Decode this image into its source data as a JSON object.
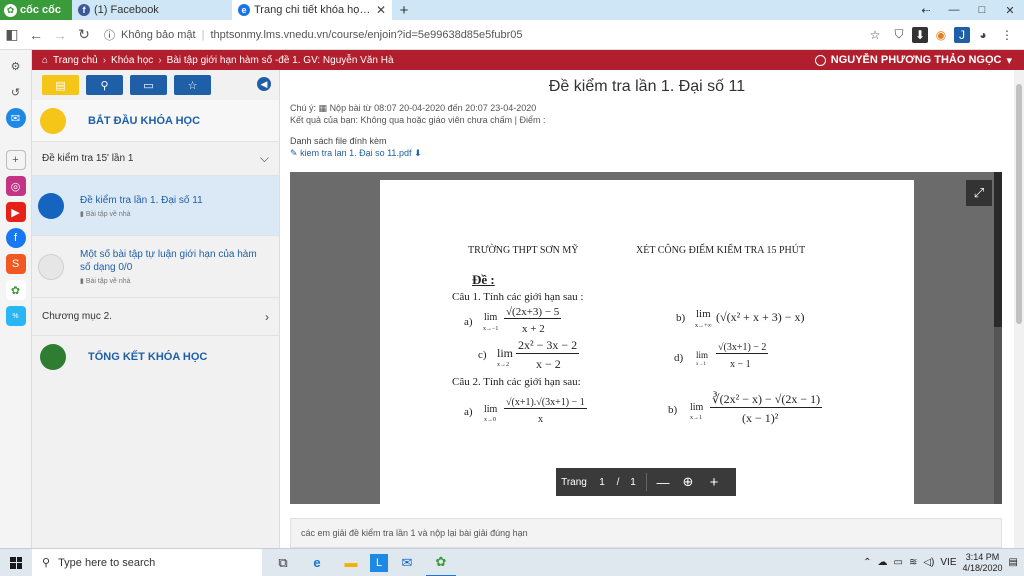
{
  "browser": {
    "brand": "cốc cốc",
    "tabs": [
      {
        "title": "(1) Facebook",
        "active": false
      },
      {
        "title": "Trang chi tiết khóa học: Bài tậ",
        "active": true
      }
    ],
    "address": {
      "security": "Không bảo mật",
      "url": "thptsonmy.lms.vnedu.vn/course/enjoin?id=5e99638d85e5fubr05"
    }
  },
  "site": {
    "breadcrumbs": [
      "Trang chủ",
      "Khóa học",
      "Bài tập giới hạn hàm số -đề 1. GV: Nguyễn Văn Hà"
    ],
    "user": "NGUYỄN PHƯƠNG THẢO NGỌC"
  },
  "course_panel": {
    "start": "BẮT ĐẦU KHÓA HỌC",
    "section1": "Đề kiểm tra 15' lần 1",
    "items": [
      {
        "title": "Đề kiểm tra lần 1. Đại số 11",
        "sub": "Bài tập về nhà",
        "selected": true
      },
      {
        "title": "Một số bài tập tự luận giới hạn của hàm số dạng 0/0",
        "sub": "Bài tập về nhà",
        "selected": false
      }
    ],
    "section2": "Chương mục 2.",
    "end": "TỔNG KẾT KHÓA HỌC"
  },
  "main": {
    "title": "Đề kiểm tra lần 1. Đại số 11",
    "note_label": "Chú ý:",
    "note": "Nộp bài từ 08:07 20-04-2020 đến 20:07 23-04-2020",
    "result": "Kết quả của bạn: Không qua hoặc giáo viên chưa chấm | Điểm :",
    "files_label": "Danh sách file đính kèm",
    "file": "kiem tra lan 1. Đại so 11.pdf",
    "comment": "các em giải đề kiểm tra lần 1 và nộp lại bài giải đúng hạn"
  },
  "document": {
    "school": "TRƯỜNG THPT SƠN MỸ",
    "exam": "XÉT CÔNG ĐIỂM KIỂM TRA 15 PHÚT",
    "de": "Đề :",
    "q1": "Câu 1. Tính các giới hạn sau :",
    "q2": "Câu 2. Tính các giới hạn sau:",
    "parts": [
      "a)",
      "b)",
      "c)",
      "d)",
      "a)",
      "b)"
    ],
    "lim": "lim",
    "subs": [
      "x→−1",
      "x→+∞",
      "x→2",
      "x→1",
      "x→0",
      "x→1"
    ],
    "num1": "√(2x+3) − 5",
    "den1": "x + 2",
    "expr_b": "(√(x² + x + 3) − x)",
    "num_c": "2x² − 3x − 2",
    "den_c": "x − 2",
    "num_d": "√(3x+1) − 2",
    "den_d": "x − 1",
    "num_2a": "√(x+1).√(3x+1) − 1",
    "den_2a": "x",
    "num_2b": "∛(2x² − x) − √(2x − 1)",
    "den_2b": "(x − 1)²"
  },
  "pdf_toolbar": {
    "label": "Trang",
    "page": "1",
    "sep": "/",
    "total": "1"
  },
  "taskbar": {
    "search_placeholder": "Type here to search",
    "lang": "VIE",
    "time": "3:14 PM",
    "date": "4/18/2020"
  }
}
